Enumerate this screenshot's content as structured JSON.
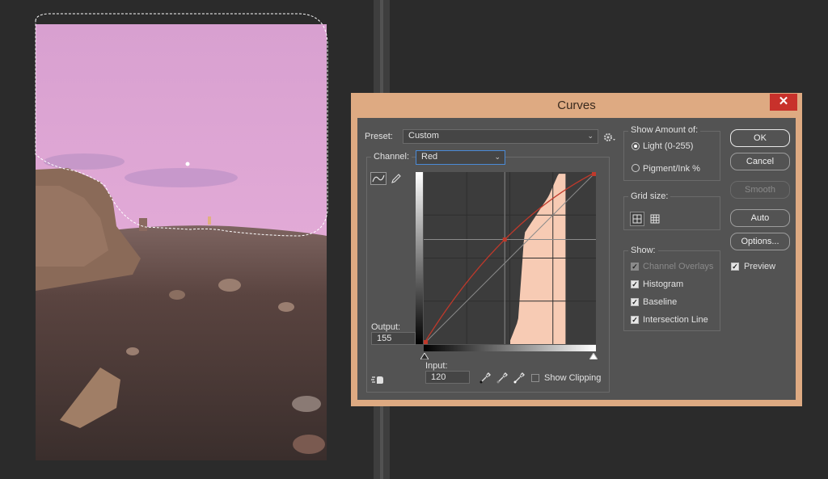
{
  "dialog": {
    "title": "Curves",
    "close_glyph": "✕"
  },
  "preset": {
    "label": "Preset:",
    "value": "Custom"
  },
  "channel": {
    "label": "Channel:",
    "value": "Red"
  },
  "output": {
    "label": "Output:",
    "value": "155"
  },
  "input": {
    "label": "Input:",
    "value": "120"
  },
  "show_clipping": {
    "label": "Show Clipping",
    "checked": false
  },
  "show_amount": {
    "title": "Show Amount of:",
    "options": [
      {
        "label": "Light  (0-255)",
        "selected": true
      },
      {
        "label": "Pigment/Ink %",
        "selected": false
      }
    ]
  },
  "grid_size": {
    "title": "Grid size:"
  },
  "show": {
    "title": "Show:",
    "items": [
      {
        "label": "Channel Overlays",
        "checked": true,
        "disabled": true
      },
      {
        "label": "Histogram",
        "checked": true,
        "disabled": false
      },
      {
        "label": "Baseline",
        "checked": true,
        "disabled": false
      },
      {
        "label": "Intersection Line",
        "checked": true,
        "disabled": false
      }
    ]
  },
  "buttons": {
    "ok": "OK",
    "cancel": "Cancel",
    "smooth": "Smooth",
    "auto": "Auto",
    "options": "Options..."
  },
  "preview": {
    "label": "Preview",
    "checked": true
  },
  "check_glyph": "✓",
  "colors": {
    "curve": "#c0392b",
    "histogram": "#f7cbb4",
    "graph_bg": "#3c3c3c",
    "dialog_frame": "#deaa82",
    "close_button": "#c8312b"
  },
  "icons": [
    "curve-tool-icon",
    "pencil-icon",
    "gear-icon",
    "black-eyedropper-icon",
    "gray-eyedropper-icon",
    "white-eyedropper-icon",
    "on-image-adjust-icon",
    "grid-4-icon",
    "grid-10-icon"
  ]
}
